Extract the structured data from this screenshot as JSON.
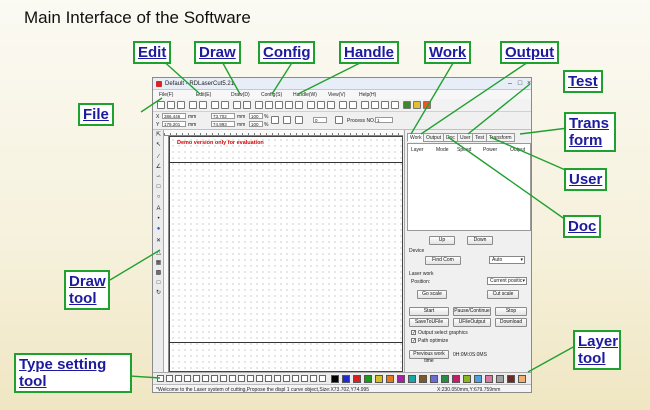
{
  "slide": {
    "title": "Main Interface of the Software"
  },
  "callouts": {
    "edit": "Edit",
    "draw": "Draw",
    "config": "Config",
    "handle": "Handle",
    "work": "Work",
    "output": "Output",
    "test": "Test",
    "transform": "Trans form",
    "file": "File",
    "user": "User",
    "doc": "Doc",
    "draw_tool": "Draw tool",
    "layer_tool": "Layer tool",
    "type_setting_tool": "Type setting tool"
  },
  "window": {
    "title": "Default - RDLaserCut5.21",
    "menu": [
      "File(F)",
      "Edit(E)",
      "Draw(D)",
      "Config(S)",
      "Handle(W)",
      "View(V)",
      "Help(H)"
    ],
    "coords": {
      "x_label": "X",
      "x_value": "386.446",
      "y_label": "Y",
      "y_value": "179.201",
      "unit": "mm",
      "w_value": "73.702",
      "h_value": "74.993",
      "pct_w": "100",
      "pct_h": "100",
      "pct": "%",
      "angle": "0",
      "process_no_label": "Process NO.",
      "process_no": "1"
    },
    "demo_text": "Demo version only for evaluation",
    "tabs": [
      "Work",
      "Output",
      "Doc",
      "User",
      "Test",
      "Transform"
    ],
    "layer_columns": [
      "Layer",
      "Mode",
      "Speed",
      "Power",
      "Output"
    ],
    "buttons": {
      "up": "Up",
      "down": "Down",
      "find_com": "Find Com",
      "go_scale": "Go scale",
      "cut_scale": "Cut scale",
      "start": "Start",
      "pause": "Pause/Continue",
      "stop": "Stop",
      "save_to_ufile": "SaveToUFile",
      "ufile_output": "UFileOutput",
      "download": "Download",
      "prev_work_time": "Previous work time"
    },
    "device_label": "Device",
    "com_value": "Auto",
    "laser_work_label": "Laser work",
    "position_label": "Position:",
    "position_value": "Current positic",
    "opt_output_select": "Output select graphics",
    "opt_path_optimize": "Path optimize",
    "work_time": "0H:0M:0S:0MS",
    "status_message": "*Welcome to the Laser system of cutting,Propose the displ 1 curve object,Size:X73.702,Y74.995",
    "status_coords": "X:230.050mm,Y:679.759mm",
    "palette": [
      "#000000",
      "#1e2ad8",
      "#d91f1f",
      "#1a9a1a",
      "#d4c21a",
      "#e07a1a",
      "#a61fa6",
      "#1aa6a6",
      "#7a5a2a",
      "#6a6ad8",
      "#2a8a4a",
      "#c81a6a",
      "#8ab81a",
      "#4aa0e0",
      "#d87aa0",
      "#a0a0a0",
      "#6a2a2a",
      "#f0b070"
    ]
  }
}
